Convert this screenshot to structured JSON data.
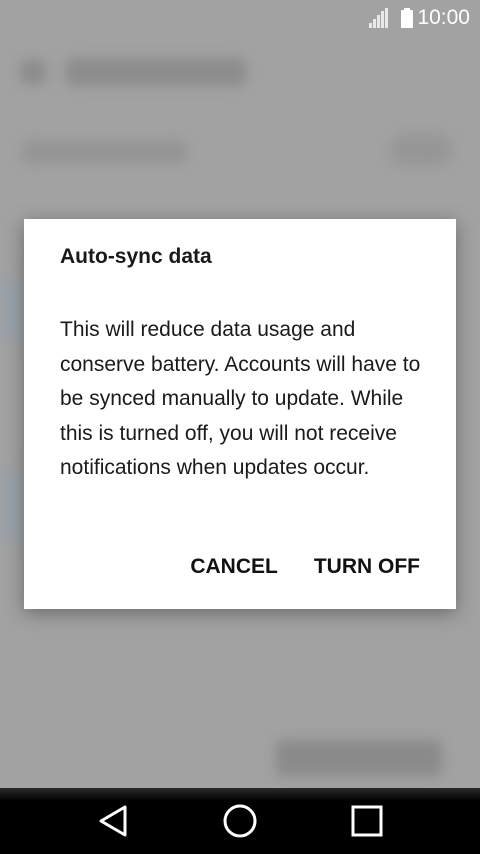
{
  "status_bar": {
    "time": "10:00",
    "icons": [
      "signal-icon",
      "battery-icon"
    ]
  },
  "dialog": {
    "title": "Auto-sync data",
    "message": "This will reduce data usage and conserve battery. Accounts will have to be synced manually to update. While this is turned off, you will not receive notifications when updates occur.",
    "cancel_label": "CANCEL",
    "confirm_label": "TURN OFF"
  },
  "nav_bar": {
    "icons": [
      "back-icon",
      "home-icon",
      "recents-icon"
    ]
  },
  "colors": {
    "dialog_background": "#ffffff",
    "scrim": "#9e9e9e",
    "text": "#1a1a1a",
    "nav_background": "#000000"
  }
}
